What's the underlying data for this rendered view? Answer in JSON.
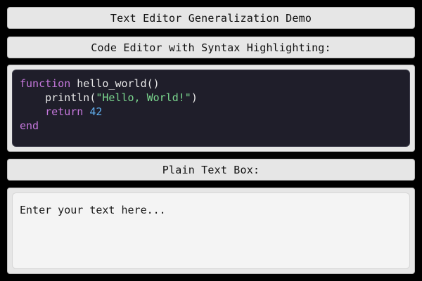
{
  "header": {
    "title": "Text Editor Generalization Demo"
  },
  "code_section": {
    "label": "Code Editor with Syntax Highlighting:",
    "lines": [
      [
        {
          "type": "keyword",
          "text": "function"
        },
        {
          "type": "plain",
          "text": " hello_world()"
        }
      ],
      [
        {
          "type": "plain",
          "text": "    println("
        },
        {
          "type": "string",
          "text": "\"Hello, World!\""
        },
        {
          "type": "plain",
          "text": ")"
        }
      ],
      [
        {
          "type": "plain",
          "text": "    "
        },
        {
          "type": "keyword",
          "text": "return"
        },
        {
          "type": "plain",
          "text": " "
        },
        {
          "type": "number",
          "text": "42"
        }
      ],
      [
        {
          "type": "keyword",
          "text": "end"
        }
      ]
    ]
  },
  "plain_section": {
    "label": "Plain Text Box:",
    "placeholder": "Enter your text here...",
    "value": ""
  },
  "colors": {
    "background": "#000000",
    "panel": "#e6e6e6",
    "editor_bg": "#1f1e2a",
    "keyword": "#c678dd",
    "string": "#7bd88f",
    "number": "#61afef",
    "plain_code": "#e8e8e8",
    "textbox_bg": "#f4f4f4"
  }
}
